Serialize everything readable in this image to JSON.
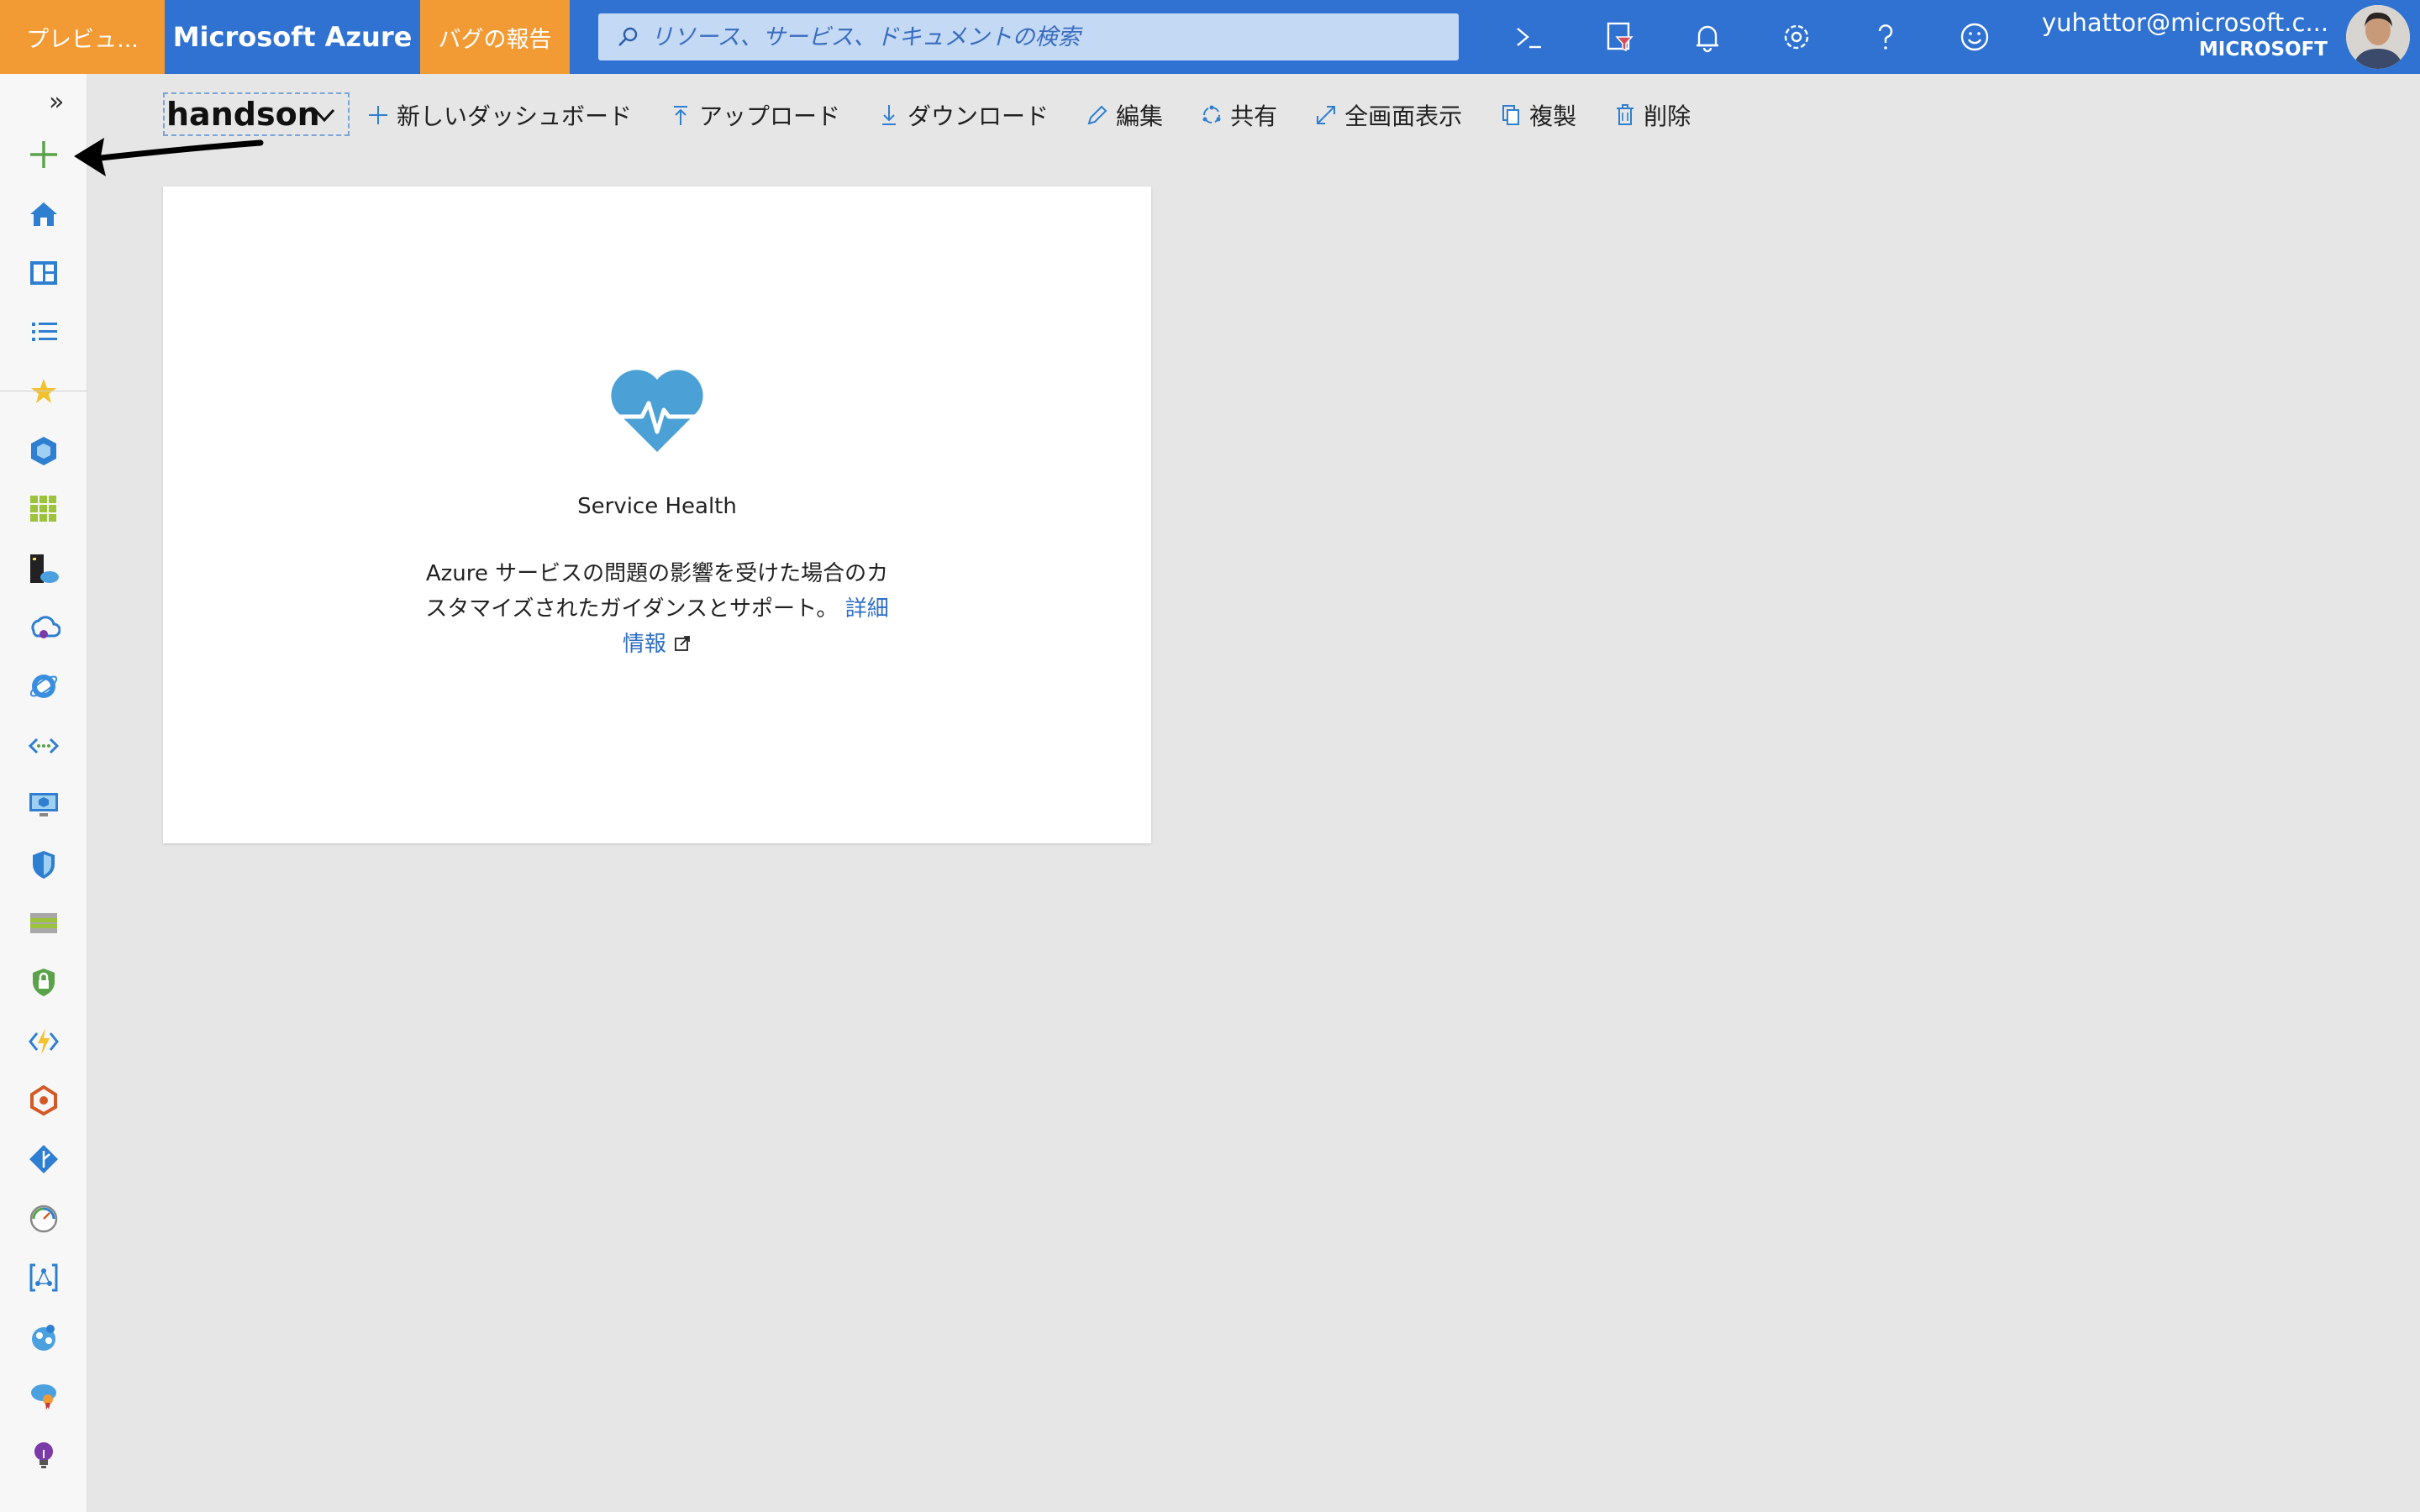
{
  "topbar": {
    "preview_label": "プレビュ...",
    "brand": "Microsoft Azure",
    "bug_report": "バグの報告",
    "search_placeholder": "リソース、サービス、ドキュメントの検索",
    "account_email": "yuhattor@microsoft.c...",
    "account_org": "MICROSOFT",
    "icons": [
      "cloud-shell-icon",
      "directory-filter-icon",
      "notifications-icon",
      "settings-icon",
      "help-icon",
      "feedback-icon"
    ]
  },
  "rail": {
    "expand_glyph": "»",
    "items": [
      "create-resource-icon",
      "home-icon",
      "dashboard-icon",
      "all-services-icon",
      "favorites-star-icon",
      "all-resources-icon",
      "resource-groups-icon",
      "app-services-icon",
      "cloud-service-icon",
      "cosmos-db-icon",
      "virtual-network-icon",
      "virtual-machines-icon",
      "security-center-icon",
      "storage-icon",
      "key-vault-icon",
      "function-app-icon",
      "kubernetes-icon",
      "devops-icon",
      "monitor-icon",
      "logic-apps-icon",
      "service-fabric-icon",
      "advisor-icon",
      "lightbulb-icon"
    ]
  },
  "dashboard": {
    "name": "handson",
    "toolbar": [
      {
        "label": "新しいダッシュボード",
        "icon": "plus-icon"
      },
      {
        "label": "アップロード",
        "icon": "upload-icon"
      },
      {
        "label": "ダウンロード",
        "icon": "download-icon"
      },
      {
        "label": "編集",
        "icon": "pencil-icon"
      },
      {
        "label": "共有",
        "icon": "share-icon"
      },
      {
        "label": "全画面表示",
        "icon": "fullscreen-icon"
      },
      {
        "label": "複製",
        "icon": "clone-icon"
      },
      {
        "label": "削除",
        "icon": "trash-icon"
      }
    ]
  },
  "tile": {
    "title": "Service Health",
    "description_line1": "Azure サービスの問題の影響を受けた場合のカ",
    "description_line2": "スタマイズされたガイダンスとサポート。",
    "link_part1": "詳細",
    "link_part2": "情報"
  },
  "colors": {
    "topbar": "#2f72d2",
    "preview_tab": "#f29a34",
    "accent_link": "#2f6ec7"
  }
}
